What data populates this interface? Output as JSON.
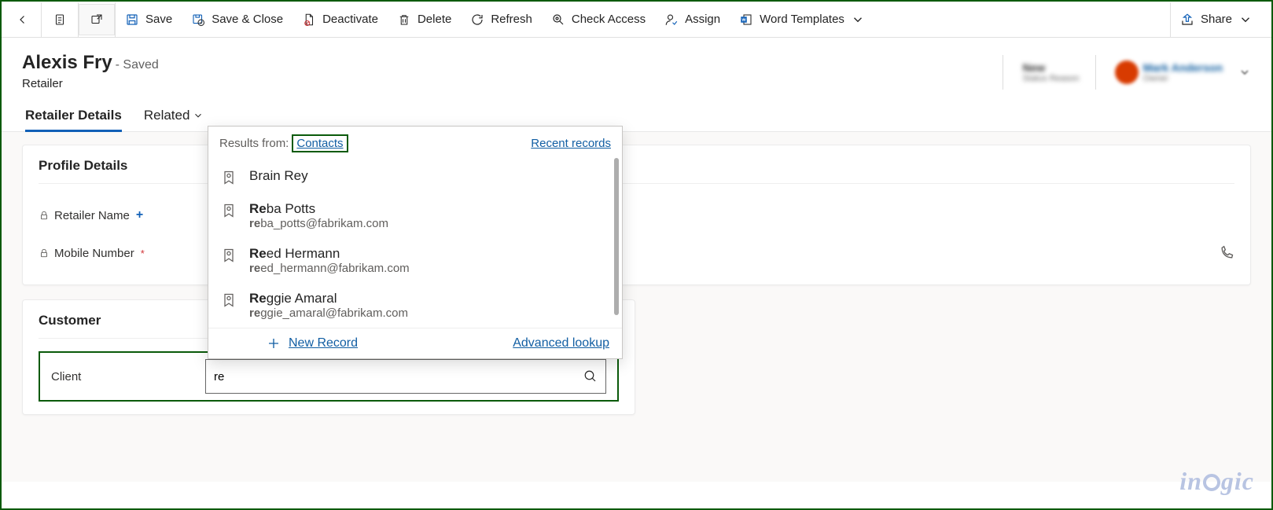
{
  "toolbar": {
    "save": "Save",
    "saveclose": "Save & Close",
    "deactivate": "Deactivate",
    "delete": "Delete",
    "refresh": "Refresh",
    "checkaccess": "Check Access",
    "assign": "Assign",
    "wordtemplates": "Word Templates",
    "share": "Share"
  },
  "record": {
    "title": "Alexis Fry",
    "status": "- Saved",
    "entity": "Retailer"
  },
  "header_right": {
    "stat1_value": "New",
    "stat1_label": "Status Reason",
    "owner_name": "Mark Anderson",
    "owner_label": "Owner"
  },
  "tabs": {
    "details": "Retailer Details",
    "related": "Related"
  },
  "sections": {
    "profile": "Profile Details",
    "customer": "Customer"
  },
  "fields": {
    "retailer_name": "Retailer Name",
    "mobile_number": "Mobile Number",
    "client": "Client"
  },
  "lookup": {
    "query": "re",
    "results_from": "Results from:",
    "results_entity": "Contacts",
    "recent": "Recent records",
    "new_record": "New Record",
    "advanced": "Advanced lookup",
    "items": [
      {
        "name_pre": "",
        "name_match": "",
        "name_rest": "Brain Rey",
        "sub_pre": "",
        "sub_match": "",
        "sub_rest": ""
      },
      {
        "name_pre": "",
        "name_match": "Re",
        "name_rest": "ba Potts",
        "sub_pre": "",
        "sub_match": "re",
        "sub_rest": "ba_potts@fabrikam.com"
      },
      {
        "name_pre": "",
        "name_match": "Re",
        "name_rest": "ed Hermann",
        "sub_pre": "",
        "sub_match": "re",
        "sub_rest": "ed_hermann@fabrikam.com"
      },
      {
        "name_pre": "",
        "name_match": "Re",
        "name_rest": "ggie Amaral",
        "sub_pre": "",
        "sub_match": "re",
        "sub_rest": "ggie_amaral@fabrikam.com"
      }
    ]
  },
  "watermark": "inogic"
}
